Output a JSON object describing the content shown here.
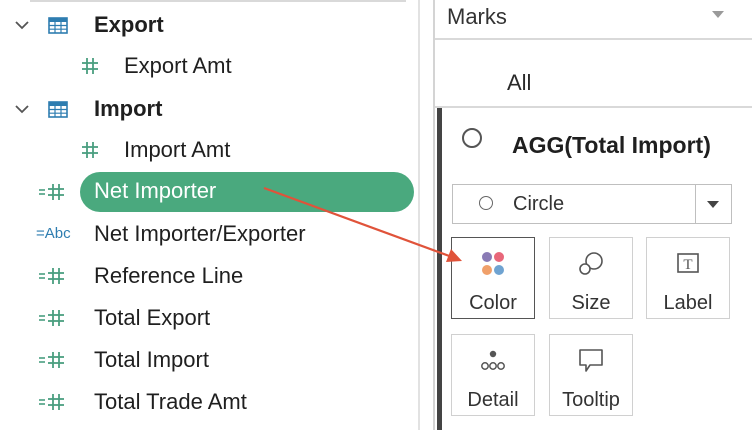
{
  "data_pane": {
    "tables": [
      {
        "name": "Export",
        "measure": "Export Amt"
      },
      {
        "name": "Import",
        "measure": "Import Amt"
      }
    ],
    "calc_fields": [
      {
        "name": "Net Importer",
        "type": "number",
        "selected": true
      },
      {
        "name": "Net Importer/Exporter",
        "type": "string",
        "type_label": "=Abc"
      },
      {
        "name": "Reference Line",
        "type": "number"
      },
      {
        "name": "Total Export",
        "type": "number"
      },
      {
        "name": "Total Import",
        "type": "number"
      },
      {
        "name": "Total Trade Amt",
        "type": "number"
      }
    ]
  },
  "marks_card": {
    "title": "Marks",
    "all_label": "All",
    "measure_title": "AGG(Total Import)",
    "mark_type": "Circle",
    "buttons": [
      {
        "label": "Color",
        "icon": "color-icon",
        "active": true
      },
      {
        "label": "Size",
        "icon": "size-icon"
      },
      {
        "label": "Label",
        "icon": "label-icon",
        "glyph": "T"
      },
      {
        "label": "Detail",
        "icon": "detail-icon"
      },
      {
        "label": "Tooltip",
        "icon": "tooltip-icon"
      }
    ]
  },
  "colors": {
    "selected_pill": "#4aa97e",
    "field_green": "#4a9e80",
    "field_blue": "#2e7db0",
    "arrow": "#e0533a",
    "color_dots": [
      "#8a7bb5",
      "#e8677a",
      "#f0a06a",
      "#6fa3d1"
    ]
  }
}
